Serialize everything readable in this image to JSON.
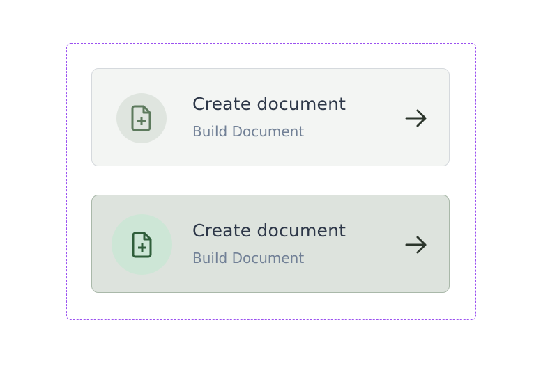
{
  "cards": [
    {
      "title": "Create document",
      "subtitle": "Build Document",
      "state": "default",
      "icon": "file-plus-icon",
      "icon_color": "#5d7a5d"
    },
    {
      "title": "Create document",
      "subtitle": "Build Document",
      "state": "hover",
      "icon": "file-plus-icon",
      "icon_color": "#2f5e3a"
    }
  ]
}
